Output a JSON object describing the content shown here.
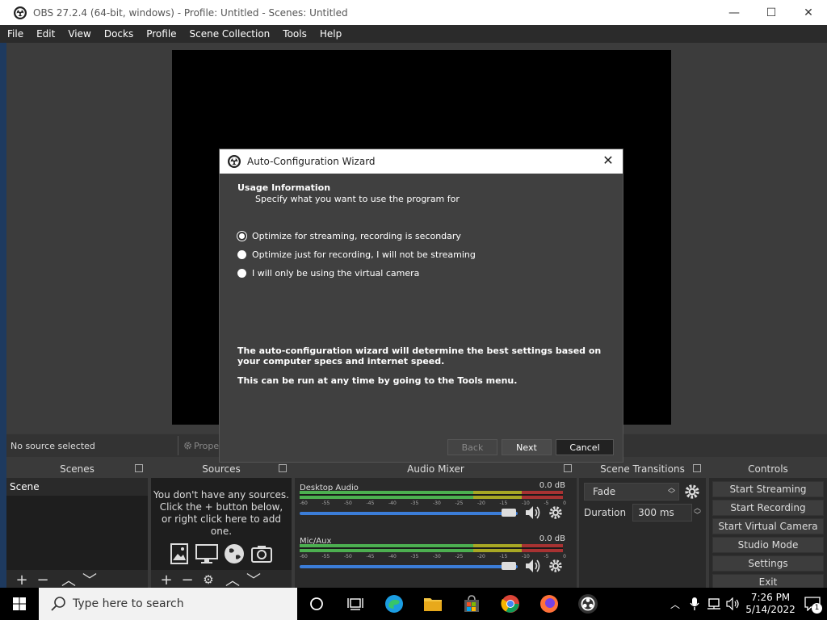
{
  "window": {
    "title": "OBS 27.2.4 (64-bit, windows) - Profile: Untitled - Scenes: Untitled",
    "minimize": "—",
    "maximize": "☐",
    "close": "✕"
  },
  "menu": [
    "File",
    "Edit",
    "View",
    "Docks",
    "Profile",
    "Scene Collection",
    "Tools",
    "Help"
  ],
  "source_bar": {
    "no_source": "No source selected",
    "properties": "Propert"
  },
  "docks": {
    "scenes": {
      "title": "Scenes",
      "items": [
        "Scene"
      ]
    },
    "sources": {
      "title": "Sources",
      "empty_line1": "You don't have any sources.",
      "empty_line2": "Click the + button below,",
      "empty_line3": "or right click here to add one."
    },
    "mixer": {
      "title": "Audio Mixer",
      "tracks": [
        {
          "name": "Desktop Audio",
          "db": "0.0 dB"
        },
        {
          "name": "Mic/Aux",
          "db": "0.0 dB"
        }
      ],
      "ticks": [
        "-60",
        "-55",
        "-50",
        "-45",
        "-40",
        "-35",
        "-30",
        "-25",
        "-20",
        "-15",
        "-10",
        "-5",
        "0"
      ]
    },
    "transitions": {
      "title": "Scene Transitions",
      "selected": "Fade",
      "duration_label": "Duration",
      "duration_value": "300 ms"
    },
    "controls": {
      "title": "Controls",
      "buttons": [
        "Start Streaming",
        "Start Recording",
        "Start Virtual Camera",
        "Studio Mode",
        "Settings",
        "Exit"
      ]
    }
  },
  "dialog": {
    "title": "Auto-Configuration Wizard",
    "heading": "Usage Information",
    "subheading": "Specify what you want to use the program for",
    "options": [
      "Optimize for streaming, recording is secondary",
      "Optimize just for recording, I will not be streaming",
      "I will only be using the virtual camera"
    ],
    "info1": "The auto-configuration wizard will determine the best settings based on your computer specs and internet speed.",
    "info2": "This can be run at any time by going to the Tools menu.",
    "back": "Back",
    "next": "Next",
    "cancel": "Cancel"
  },
  "taskbar": {
    "search_placeholder": "Type here to search",
    "time": "7:26 PM",
    "date": "5/14/2022",
    "notification_count": "1"
  }
}
